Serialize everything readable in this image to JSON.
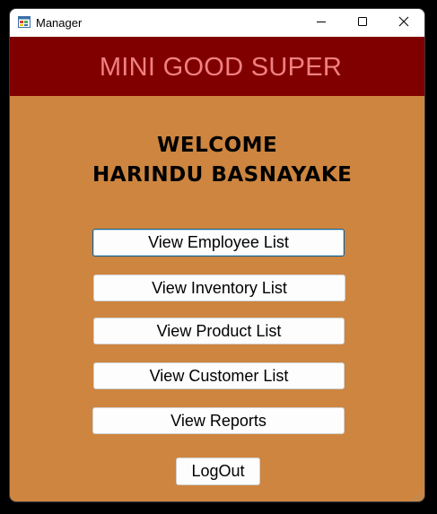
{
  "window": {
    "title": "Manager",
    "app_icon": "windows-forms-app-icon",
    "controls": {
      "minimize_icon": "minimize-icon",
      "maximize_icon": "maximize-icon",
      "close_icon": "close-icon"
    }
  },
  "banner": {
    "title": "MINI GOOD SUPER"
  },
  "welcome": {
    "line1": "Welcome",
    "line2": "Harindu Basnayake"
  },
  "buttons": {
    "employee": "View Employee List",
    "inventory": "View Inventory List",
    "product": "View Product List",
    "customer": "View Customer List",
    "reports": "View Reports",
    "logout": "LogOut"
  },
  "colors": {
    "background": "#cd853f",
    "banner_background": "#800000",
    "banner_text": "#f08080",
    "focus_border": "#0e639c"
  }
}
